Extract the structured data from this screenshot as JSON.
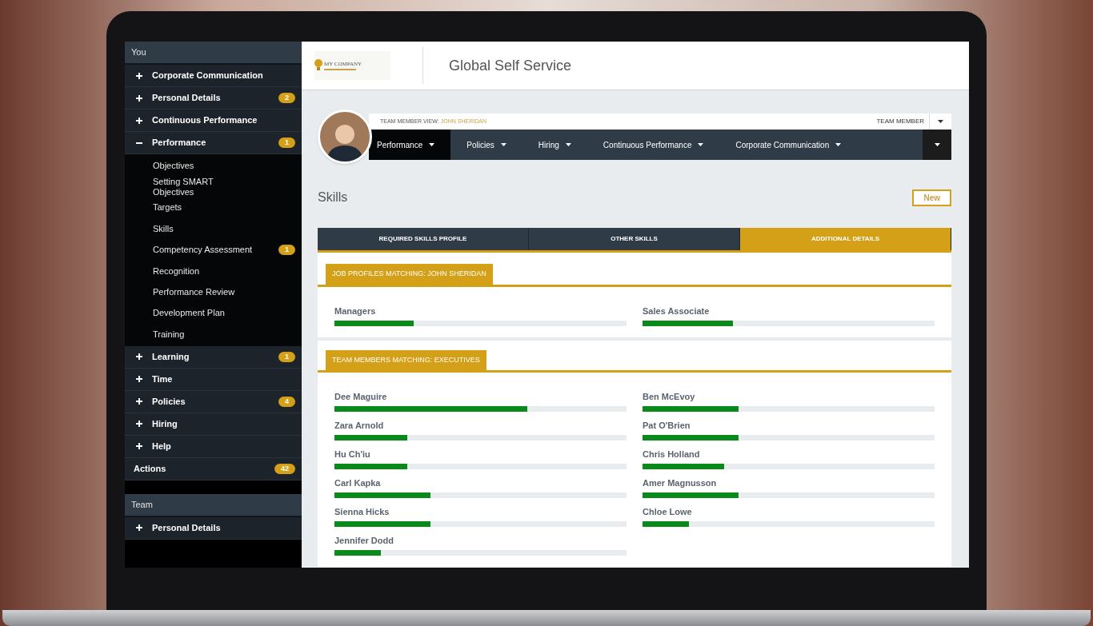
{
  "sidebar": {
    "sections": [
      {
        "title": "You",
        "items": [
          {
            "label": "Corporate Communication",
            "kind": "group",
            "expanded": false
          },
          {
            "label": "Personal Details",
            "kind": "group",
            "expanded": false,
            "badge": "2"
          },
          {
            "label": "Continuous Performance",
            "kind": "group",
            "expanded": false
          },
          {
            "label": "Performance",
            "kind": "group",
            "expanded": true,
            "badge": "1",
            "children": [
              {
                "label": "Objectives"
              },
              {
                "label": "Setting SMART Objectives"
              },
              {
                "label": "Targets"
              },
              {
                "label": "Skills"
              },
              {
                "label": "Competency Assessment",
                "badge": "1"
              },
              {
                "label": "Recognition"
              },
              {
                "label": "Performance Review"
              },
              {
                "label": "Development Plan"
              },
              {
                "label": "Training"
              }
            ]
          },
          {
            "label": "Learning",
            "kind": "group",
            "expanded": false,
            "badge": "1"
          },
          {
            "label": "Time",
            "kind": "group",
            "expanded": false
          },
          {
            "label": "Policies",
            "kind": "group",
            "expanded": false,
            "badge": "4"
          },
          {
            "label": "Hiring",
            "kind": "group",
            "expanded": false
          },
          {
            "label": "Help",
            "kind": "group",
            "expanded": false
          },
          {
            "label": "Actions",
            "kind": "link",
            "badge": "42"
          }
        ]
      },
      {
        "title": "Team",
        "items": [
          {
            "label": "Personal Details",
            "kind": "group",
            "expanded": false
          }
        ]
      }
    ]
  },
  "header": {
    "logo_name": "MY COMPANY",
    "title": "Global Self Service"
  },
  "profile_bar": {
    "view_label": "TEAM MEMBER VIEW:",
    "view_name": "JOHN SHERIDAN",
    "role": "TEAM MEMBER",
    "nav": [
      {
        "label": "Performance",
        "selected": true
      },
      {
        "label": "Policies",
        "selected": false
      },
      {
        "label": "Hiring",
        "selected": false
      },
      {
        "label": "Continuous Performance",
        "selected": false
      },
      {
        "label": "Corporate Communication",
        "selected": false
      }
    ]
  },
  "page": {
    "title": "Skills",
    "new_button": "New",
    "tabs": [
      {
        "label": "REQUIRED SKILLS PROFILE",
        "selected": false
      },
      {
        "label": "OTHER SKILLS",
        "selected": false
      },
      {
        "label": "ADDITIONAL DETAILS",
        "selected": true
      }
    ],
    "sections": [
      {
        "title": "JOB PROFILES MATCHING: JOHN SHERIDAN",
        "items": [
          {
            "name": "Managers",
            "level": 0.27
          },
          {
            "name": "Sales Associate",
            "level": 0.31
          }
        ]
      },
      {
        "title": "TEAM MEMBERS MATCHING: EXECUTIVES",
        "items": [
          {
            "name": "Dee Maguire",
            "level": 0.66
          },
          {
            "name": "Ben McEvoy",
            "level": 0.33
          },
          {
            "name": "Zara Arnold",
            "level": 0.25
          },
          {
            "name": "Pat O'Brien",
            "level": 0.33
          },
          {
            "name": "Hu Ch'iu",
            "level": 0.25
          },
          {
            "name": "Chris Holland",
            "level": 0.28
          },
          {
            "name": "Carl Kapka",
            "level": 0.33
          },
          {
            "name": "Amer Magnusson",
            "level": 0.33
          },
          {
            "name": "Sienna Hicks",
            "level": 0.33
          },
          {
            "name": "Chloe Lowe",
            "level": 0.16
          },
          {
            "name": "Jennifer Dodd",
            "level": 0.16
          }
        ]
      }
    ]
  }
}
